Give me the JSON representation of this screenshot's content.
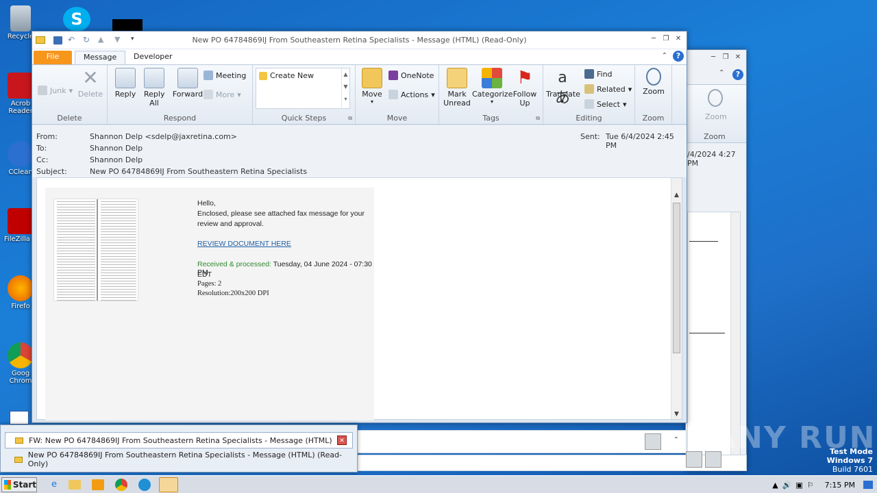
{
  "desktop": {
    "icons": [
      {
        "label": "Recycle"
      },
      {
        "label": "Acrob Reader"
      },
      {
        "label": "CClean"
      },
      {
        "label": "FileZilla C"
      },
      {
        "label": "Firefo"
      },
      {
        "label": "Goog Chrom"
      }
    ]
  },
  "window": {
    "title": "New PO 64784869IJ From Southeastern Retina Specialists - Message (HTML) (Read-Only)",
    "tabs": {
      "file": "File",
      "message": "Message",
      "developer": "Developer"
    },
    "ribbon": {
      "delete_group": {
        "junk": "Junk",
        "delete": "Delete",
        "label": "Delete"
      },
      "respond_group": {
        "reply": "Reply",
        "reply_all": "Reply All",
        "forward": "Forward",
        "meeting": "Meeting",
        "more": "More",
        "label": "Respond"
      },
      "quicksteps_group": {
        "create_new": "Create New",
        "label": "Quick Steps"
      },
      "move_group": {
        "move": "Move",
        "onenote": "OneNote",
        "actions": "Actions",
        "label": "Move"
      },
      "tags_group": {
        "mark_unread": "Mark Unread",
        "categorize": "Categorize",
        "follow_up": "Follow Up",
        "label": "Tags"
      },
      "editing_group": {
        "translate": "Translate",
        "find": "Find",
        "related": "Related",
        "select": "Select",
        "label": "Editing"
      },
      "zoom_group": {
        "zoom": "Zoom",
        "label": "Zoom"
      }
    },
    "header": {
      "from_label": "From:",
      "from_value": "Shannon Delp <sdelp@jaxretina.com>",
      "to_label": "To:",
      "to_value": "Shannon Delp",
      "cc_label": "Cc:",
      "cc_value": "Shannon Delp",
      "subject_label": "Subject:",
      "subject_value": "New PO 64784869IJ From Southeastern Retina Specialists",
      "sent_label": "Sent:",
      "sent_value": "Tue 6/4/2024 2:45 PM"
    },
    "message": {
      "greeting": "Hello,",
      "line1": "Enclosed, please see attached fax message for your",
      "line2": "review and approval.",
      "link": "REVIEW DOCUMENT HERE",
      "received_label": "Received & processed:",
      "received_value": " Tuesday, 04 June 2024 - 07:30 PM",
      "tz": "EDT",
      "pages": "Pages: 2",
      "resolution": "Resolution:200x200 DPI"
    }
  },
  "back_window": {
    "sent_fragment": "/4/2024 4:27 PM",
    "zoom_label": "Zoom",
    "zoom_group": "Zoom"
  },
  "preview": {
    "items": [
      {
        "label": "FW: New PO 64784869IJ From Southeastern Retina Specialists - Message (HTML)"
      },
      {
        "label": "New PO 64784869IJ From Southeastern Retina Specialists - Message (HTML) (Read-Only)"
      }
    ]
  },
  "taskbar": {
    "start": "Start",
    "clock": "7:15 PM"
  },
  "watermark": {
    "line1": "Test Mode",
    "line2": "Windows 7",
    "line3": "Build 7601",
    "brand": "ANY RUN"
  },
  "colors": {
    "file_tab": "#f7961d",
    "received_green": "#2e8b2e",
    "link": "#1f5fa8"
  }
}
